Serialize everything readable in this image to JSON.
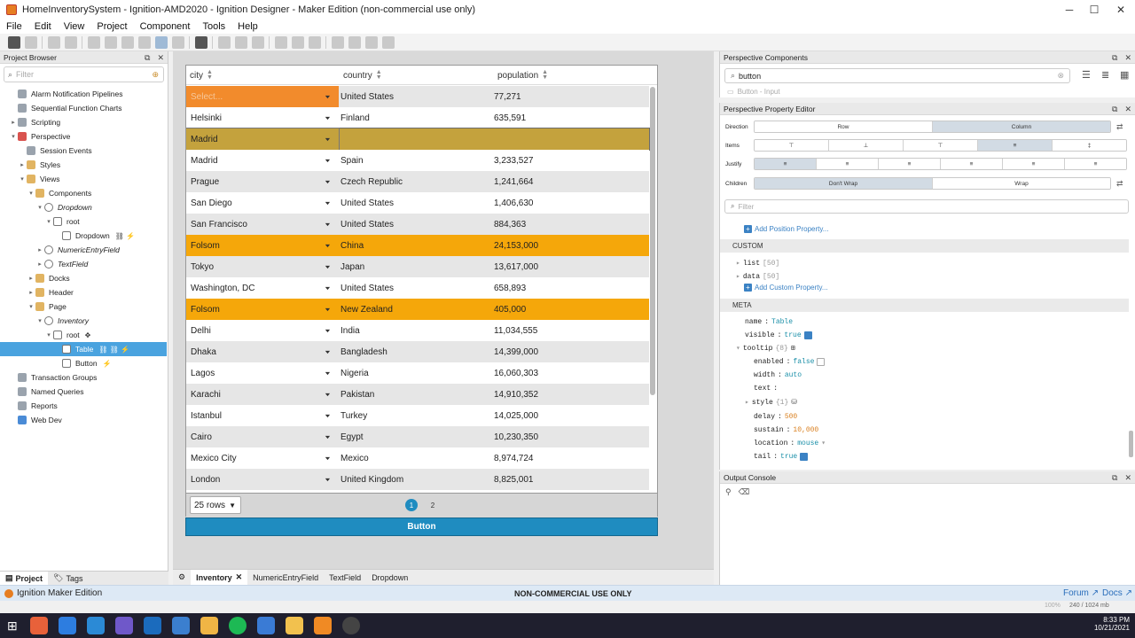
{
  "window": {
    "title": "HomeInventorySystem - Ignition-AMD2020 - Ignition Designer - Maker Edition (non-commercial use only)",
    "minimize": "─",
    "maximize": "☐",
    "close": "✕"
  },
  "menu": [
    "File",
    "Edit",
    "View",
    "Project",
    "Component",
    "Tools",
    "Help"
  ],
  "project_browser": {
    "header": "Project Browser",
    "filter_placeholder": "Filter",
    "tree": [
      {
        "label": "Alarm Notification Pipelines",
        "depth": 1,
        "icon": "gray",
        "arrow": ""
      },
      {
        "label": "Sequential Function Charts",
        "depth": 1,
        "icon": "gray",
        "arrow": ""
      },
      {
        "label": "Scripting",
        "depth": 1,
        "icon": "gray",
        "arrow": "▸"
      },
      {
        "label": "Perspective",
        "depth": 1,
        "icon": "red",
        "arrow": "▾"
      },
      {
        "label": "Session Events",
        "depth": 2,
        "icon": "gray",
        "arrow": ""
      },
      {
        "label": "Styles",
        "depth": 2,
        "icon": "folder",
        "arrow": "▸"
      },
      {
        "label": "Views",
        "depth": 2,
        "icon": "folder",
        "arrow": "▾"
      },
      {
        "label": "Components",
        "depth": 3,
        "icon": "folder",
        "arrow": "▾"
      },
      {
        "label": "Dropdown",
        "depth": 4,
        "icon": "view",
        "arrow": "▾",
        "italic": true
      },
      {
        "label": "root",
        "depth": 5,
        "icon": "comp",
        "arrow": "▾"
      },
      {
        "label": "Dropdown",
        "depth": 6,
        "icon": "comp",
        "arrow": "",
        "suffix": "⛓ ⚡"
      },
      {
        "label": "NumericEntryField",
        "depth": 4,
        "icon": "view",
        "arrow": "▸",
        "italic": true
      },
      {
        "label": "TextField",
        "depth": 4,
        "icon": "view",
        "arrow": "▸",
        "italic": true
      },
      {
        "label": "Docks",
        "depth": 3,
        "icon": "folder",
        "arrow": "▸"
      },
      {
        "label": "Header",
        "depth": 3,
        "icon": "folder",
        "arrow": "▸"
      },
      {
        "label": "Page",
        "depth": 3,
        "icon": "folder",
        "arrow": "▾"
      },
      {
        "label": "Inventory",
        "depth": 4,
        "icon": "view",
        "arrow": "▾",
        "italic": true
      },
      {
        "label": "root",
        "depth": 5,
        "icon": "comp",
        "arrow": "▾",
        "suffix": "✥"
      },
      {
        "label": "Table",
        "depth": 6,
        "icon": "comp",
        "arrow": "",
        "suffix": "⛓ ⛓ ⚡",
        "selected": true
      },
      {
        "label": "Button",
        "depth": 6,
        "icon": "comp",
        "arrow": "",
        "suffix": "⚡"
      },
      {
        "label": "Transaction Groups",
        "depth": 1,
        "icon": "gray",
        "arrow": ""
      },
      {
        "label": "Named Queries",
        "depth": 1,
        "icon": "gray",
        "arrow": ""
      },
      {
        "label": "Reports",
        "depth": 1,
        "icon": "gray",
        "arrow": ""
      },
      {
        "label": "Web Dev",
        "depth": 1,
        "icon": "blue",
        "arrow": ""
      }
    ],
    "tabs": [
      "Project",
      "Tags"
    ]
  },
  "table": {
    "columns": [
      "city",
      "country",
      "population"
    ],
    "rows": [
      {
        "city": "Select...",
        "country": "United States",
        "population": "77,271",
        "style": "editing"
      },
      {
        "city": "Helsinki",
        "country": "Finland",
        "population": "635,591",
        "style": "normal"
      },
      {
        "city": "Madrid",
        "country": "",
        "population": "",
        "style": "selected"
      },
      {
        "city": "Madrid",
        "country": "Spain",
        "population": "3,233,527",
        "style": "normal"
      },
      {
        "city": "Prague",
        "country": "Czech Republic",
        "population": "1,241,664",
        "style": "normal"
      },
      {
        "city": "San Diego",
        "country": "United States",
        "population": "1,406,630",
        "style": "normal"
      },
      {
        "city": "San Francisco",
        "country": "United States",
        "population": "884,363",
        "style": "normal"
      },
      {
        "city": "Folsom",
        "country": "China",
        "population": "24,153,000",
        "style": "highlight"
      },
      {
        "city": "Tokyo",
        "country": "Japan",
        "population": "13,617,000",
        "style": "normal"
      },
      {
        "city": "Washington, DC",
        "country": "United States",
        "population": "658,893",
        "style": "normal"
      },
      {
        "city": "Folsom",
        "country": "New Zealand",
        "population": "405,000",
        "style": "highlight"
      },
      {
        "city": "Delhi",
        "country": "India",
        "population": "11,034,555",
        "style": "normal"
      },
      {
        "city": "Dhaka",
        "country": "Bangladesh",
        "population": "14,399,000",
        "style": "normal"
      },
      {
        "city": "Lagos",
        "country": "Nigeria",
        "population": "16,060,303",
        "style": "normal"
      },
      {
        "city": "Karachi",
        "country": "Pakistan",
        "population": "14,910,352",
        "style": "normal"
      },
      {
        "city": "Istanbul",
        "country": "Turkey",
        "population": "14,025,000",
        "style": "normal"
      },
      {
        "city": "Cairo",
        "country": "Egypt",
        "population": "10,230,350",
        "style": "normal"
      },
      {
        "city": "Mexico City",
        "country": "Mexico",
        "population": "8,974,724",
        "style": "normal"
      },
      {
        "city": "London",
        "country": "United Kingdom",
        "population": "8,825,001",
        "style": "normal"
      }
    ],
    "rows_per_page": "25 rows",
    "pages": [
      "1",
      "2"
    ],
    "current_page": "1"
  },
  "button_label": "Button",
  "doc_tabs": [
    "Inventory",
    "NumericEntryField",
    "TextField",
    "Dropdown"
  ],
  "components_panel": {
    "header": "Perspective Components",
    "search_value": "button",
    "result": "Button - Input"
  },
  "property_editor": {
    "header": "Perspective Property Editor",
    "direction": {
      "label": "Direction",
      "options": [
        "Row",
        "Column"
      ],
      "selected": 1
    },
    "items_label": "Items",
    "justify_label": "Justify",
    "children": {
      "label": "Children",
      "options": [
        "Don't Wrap",
        "Wrap"
      ],
      "selected": 0
    },
    "filter_placeholder": "Filter",
    "add_position": "Add Position Property...",
    "custom_header": "CUSTOM",
    "custom": [
      {
        "key": "list",
        "count": "[50]"
      },
      {
        "key": "data",
        "count": "[50]"
      }
    ],
    "add_custom": "Add Custom Property...",
    "meta_header": "META",
    "meta": {
      "name": "Table",
      "visible": "true",
      "tooltip_count": "{8}",
      "enabled": "false",
      "width": "auto",
      "text": "",
      "style_count": "{1}",
      "delay": "500",
      "sustain": "10,000",
      "location": "mouse",
      "tail": "true"
    }
  },
  "output_console": {
    "header": "Output Console"
  },
  "status": {
    "edition": "Ignition Maker Edition",
    "banner": "NON-COMMERCIAL USE ONLY",
    "forum": "Forum",
    "docs": "Docs",
    "zoom": "100%",
    "memory": "240 / 1024 mb"
  },
  "taskbar": {
    "time": "8:33 PM",
    "date": "10/21/2021"
  },
  "colors": {
    "highlight": "#f5a70a",
    "selected_row": "#c4a23d",
    "editing": "#f28b2c",
    "accent": "#1f8cc0",
    "row_stripe": "#e6e6e6"
  }
}
